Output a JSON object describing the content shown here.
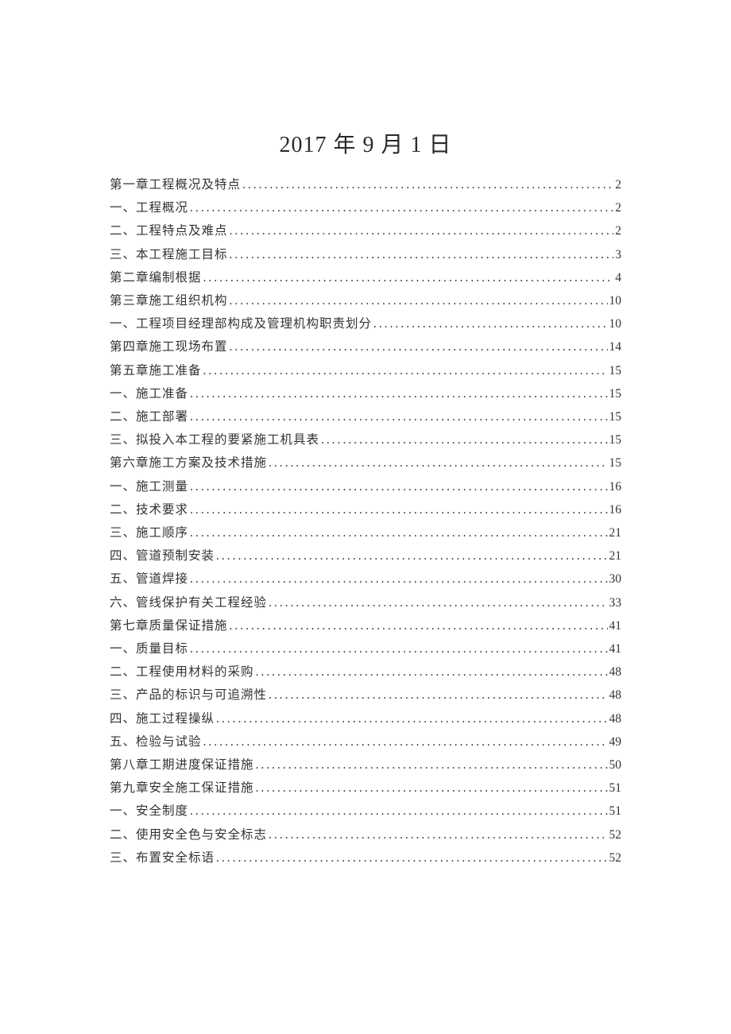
{
  "title": "2017 年 9 月 1 日",
  "toc": [
    {
      "label": "第一章工程概况及特点",
      "page": "2"
    },
    {
      "label": "一、工程概况",
      "page": "2"
    },
    {
      "label": "二、工程特点及难点",
      "page": "2"
    },
    {
      "label": "三、本工程施工目标",
      "page": "3"
    },
    {
      "label": "第二章编制根据",
      "page": "4"
    },
    {
      "label": "第三章施工组织机构",
      "page": "10"
    },
    {
      "label": "一、工程项目经理部构成及管理机构职责划分",
      "page": "10"
    },
    {
      "label": "第四章施工现场布置",
      "page": "14"
    },
    {
      "label": "第五章施工准备",
      "page": "15"
    },
    {
      "label": "一、施工准备",
      "page": "15"
    },
    {
      "label": "二、施工部署",
      "page": "15"
    },
    {
      "label": "三、拟投入本工程的要紧施工机具表",
      "page": "15"
    },
    {
      "label": "第六章施工方案及技术措施",
      "page": "15"
    },
    {
      "label": "一、施工测量",
      "page": "16"
    },
    {
      "label": "二、技术要求",
      "page": "16"
    },
    {
      "label": "三、施工顺序",
      "page": "21"
    },
    {
      "label": "四、管道预制安装",
      "page": "21"
    },
    {
      "label": "五、管道焊接",
      "page": "30"
    },
    {
      "label": "六、管线保护有关工程经验",
      "page": "33"
    },
    {
      "label": "第七章质量保证措施",
      "page": "41"
    },
    {
      "label": "一、质量目标",
      "page": "41"
    },
    {
      "label": "二、工程使用材料的采购",
      "page": "48"
    },
    {
      "label": "三、产品的标识与可追溯性",
      "page": "48"
    },
    {
      "label": "四、施工过程操纵",
      "page": "48"
    },
    {
      "label": "五、检验与试验",
      "page": "49"
    },
    {
      "label": "第八章工期进度保证措施",
      "page": "50"
    },
    {
      "label": "第九章安全施工保证措施",
      "page": "51"
    },
    {
      "label": "一、安全制度",
      "page": "51"
    },
    {
      "label": "二、使用安全色与安全标志",
      "page": "52"
    },
    {
      "label": "三、布置安全标语",
      "page": "52"
    }
  ]
}
